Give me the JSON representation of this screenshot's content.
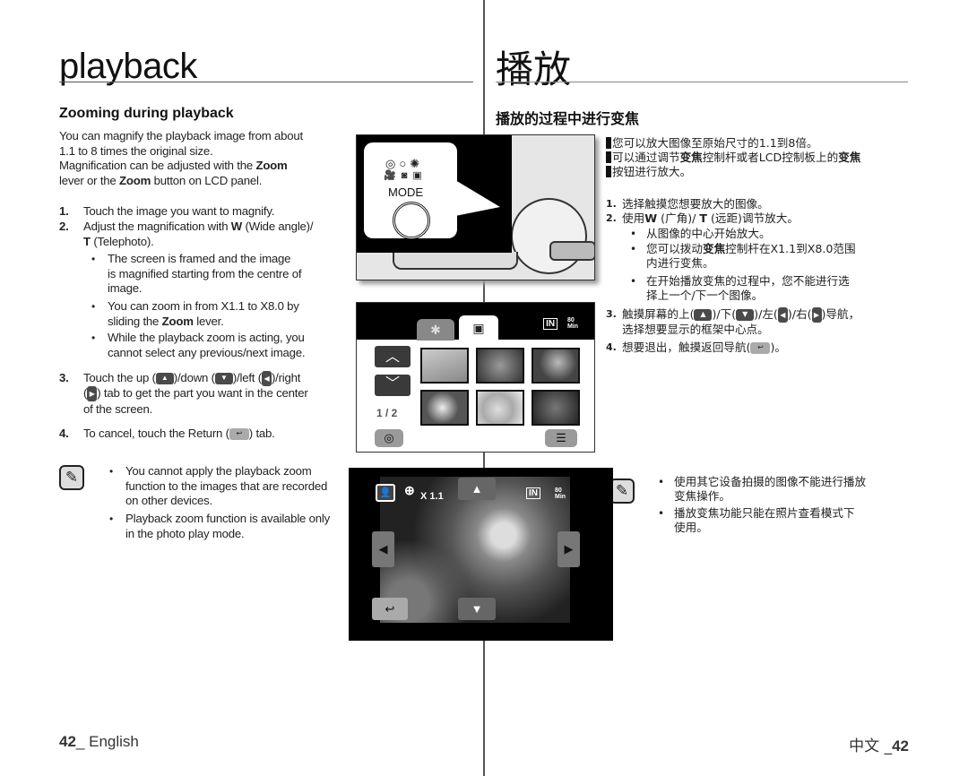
{
  "en": {
    "title": "playback",
    "section_title": "Zooming during playback",
    "intro_1": "You can magnify the playback image from about",
    "intro_2": "1.1 to 8 times the original size.",
    "intro_3a": "Magnification can be adjusted with the ",
    "intro_3b": "Zoom",
    "intro_4a": "lever or the ",
    "intro_4b": "Zoom",
    "intro_4c": " button on LCD panel.",
    "steps": [
      {
        "num": "1.",
        "text": "Touch the image you want to magnify."
      },
      {
        "num": "2.",
        "text_a": "Adjust the magnification with ",
        "bold_w": "W",
        "text_b": " (Wide angle)/",
        "bold_t": "T",
        "text_c": " (Telephoto)."
      },
      {
        "num": "3.",
        "text_a": "Touch the up (",
        "text_b": ")/down (",
        "text_c": ")/left (",
        "text_d": ")/right",
        "text_e": "(",
        "text_f": ") tab to get the part you want in the center",
        "text_g": "of the screen."
      },
      {
        "num": "4.",
        "text_a": "To cancel, touch the Return (",
        "text_b": ") tab."
      }
    ],
    "bullets": [
      {
        "line1": "The screen is framed and the image",
        "line2": "is magnified starting from the centre of",
        "line3": "image."
      },
      {
        "line1": "You can zoom in from X1.1 to X8.0 by",
        "line2a": "sliding the ",
        "line2b": "Zoom",
        "line2c": " lever."
      },
      {
        "line1": "While the playback zoom is acting, you",
        "line2": "cannot select any previous/next image."
      }
    ],
    "notes": [
      {
        "line1": "You cannot apply the playback zoom",
        "line2": "function to the images that are recorded",
        "line3": "on other devices."
      },
      {
        "line1": "Playback zoom function is available only",
        "line2": "in the photo play mode."
      }
    ],
    "footer_num": "42",
    "footer_text": "_ English"
  },
  "zh": {
    "title": "播放",
    "section_title": "播放的过程中进行变焦",
    "intro_1": "您可以放大图像至原始尺寸的1.1到8倍。",
    "intro_2a": "可以通过调节",
    "intro_2b": "变焦",
    "intro_2c": "控制杆或者LCD控制板上的",
    "intro_2d": "变焦",
    "intro_3": "按钮进行放大。",
    "steps": [
      {
        "num": "1.",
        "text": "选择触摸您想要放大的图像。"
      },
      {
        "num": "2.",
        "text_a": "使用",
        "bold_w": "W",
        "text_b": " (广角)/ ",
        "bold_t": "T",
        "text_c": " (远距)调节放大。"
      },
      {
        "num": "3.",
        "text_a": "触摸屏幕的上(",
        "text_b": ")/下(",
        "text_c": ")/左(",
        "text_d": ")/右(",
        "text_e": ")导航，",
        "text_f": "选择想要显示的框架中心点。"
      },
      {
        "num": "4.",
        "text_a": "想要退出，触摸返回导航(",
        "text_b": ")。"
      }
    ],
    "bullets": [
      {
        "line1": "从图像的中心开始放大。"
      },
      {
        "line1a": "您可以拨动",
        "line1b": "变焦",
        "line1c": "控制杆在X1.1到X8.0范围",
        "line2": "内进行变焦。"
      },
      {
        "line1": "在开始播放变焦的过程中，您不能进行选",
        "line2": "择上一个/下一个图像。"
      }
    ],
    "notes": [
      {
        "line1": "使用其它设备拍摄的图像不能进行播放",
        "line2": "变焦操作。"
      },
      {
        "line1": "播放变焦功能只能在照片查看模式下",
        "line2": "使用。"
      }
    ],
    "footer_text": "中文 _",
    "footer_num": "42"
  },
  "figures": {
    "mode_dial": {
      "label": "MODE"
    },
    "thumbnail_view": {
      "page_indicator": "1 / 2",
      "storage_label": "IN",
      "battery_label": "80\nMin",
      "thumbnails": [
        "bird",
        "leaves",
        "cactus",
        "dandelion",
        "puppies",
        "tomatoes"
      ]
    },
    "zoom_view": {
      "zoom_level": "X 1.1",
      "storage_label": "IN",
      "battery_label": "80\nMin"
    }
  },
  "icons": {
    "up": "▲",
    "down": "▼",
    "left": "◀",
    "right": "▶",
    "return": "↩",
    "chevron_up": "⌃",
    "chevron_down": "⌄",
    "camera": "◎",
    "menu": "☰",
    "note": "✎"
  }
}
